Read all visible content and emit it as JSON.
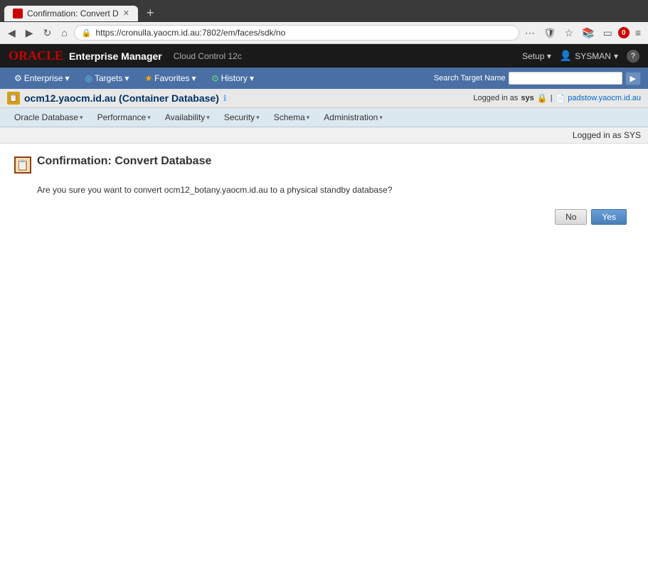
{
  "browser": {
    "tab_title": "Confirmation: Convert D",
    "url": "https://cronulla.yaocm.id.au:7802/em/faces/sdk/no",
    "new_tab_label": "+",
    "back_tooltip": "Back",
    "forward_tooltip": "Forward",
    "refresh_tooltip": "Refresh",
    "home_tooltip": "Home"
  },
  "em_header": {
    "oracle_text": "ORACLE",
    "em_title": "Enterprise Manager",
    "cloud_subtitle": "Cloud Control 12c",
    "setup_label": "Setup",
    "setup_arrow": "▾",
    "user_label": "SYSMAN",
    "user_arrow": "▾",
    "notification_count": "0",
    "help_label": "?"
  },
  "main_nav": {
    "items": [
      {
        "id": "enterprise",
        "icon": "⚙",
        "label": "Enterprise",
        "has_arrow": true
      },
      {
        "id": "targets",
        "icon": "◎",
        "label": "Targets",
        "has_arrow": true
      },
      {
        "id": "favorites",
        "icon": "★",
        "label": "Favorites",
        "has_arrow": true
      },
      {
        "id": "history",
        "icon": "🕐",
        "label": "History",
        "has_arrow": true
      }
    ],
    "search_label": "Search Target Name",
    "search_placeholder": "",
    "go_label": "▶"
  },
  "db_header": {
    "db_name": "ocm12.yaocm.id.au (Container Database)",
    "logged_in_prefix": "Logged in as",
    "logged_in_user": "sys",
    "host_label": "padstow.yaocm.id.au"
  },
  "db_menu": {
    "items": [
      {
        "id": "oracle-database",
        "label": "Oracle Database",
        "has_arrow": true
      },
      {
        "id": "performance",
        "label": "Performance",
        "has_arrow": true
      },
      {
        "id": "availability",
        "label": "Availability",
        "has_arrow": true
      },
      {
        "id": "security",
        "label": "Security",
        "has_arrow": true
      },
      {
        "id": "schema",
        "label": "Schema",
        "has_arrow": true
      },
      {
        "id": "administration",
        "label": "Administration",
        "has_arrow": true
      }
    ]
  },
  "page": {
    "logged_in_text": "Logged in as SYS",
    "confirm_title": "Confirmation: Convert Database",
    "confirm_body_prefix": "Are you sure you want to convert",
    "confirm_db_name": "ocm12_botany.yaocm.id.au",
    "confirm_body_suffix": "to a physical standby database?",
    "btn_no": "No",
    "btn_yes": "Yes"
  }
}
